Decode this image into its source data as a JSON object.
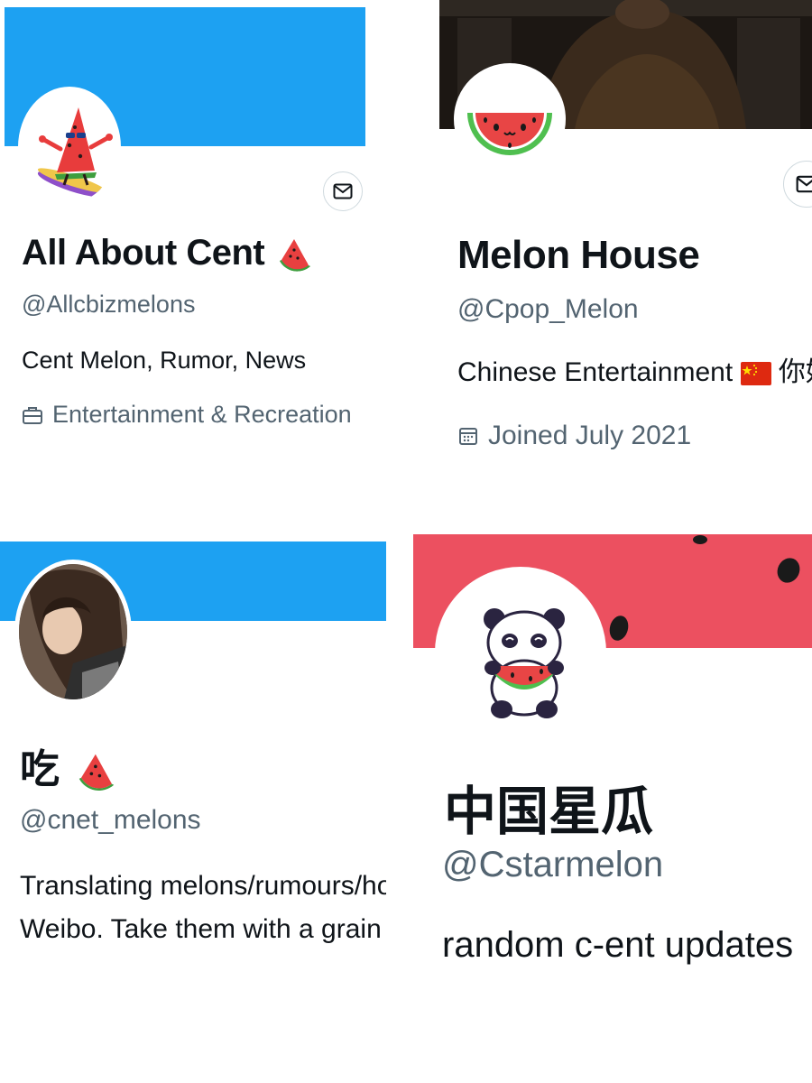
{
  "profiles": [
    {
      "banner_color": "#1da1f2",
      "display_name": "All About Cent",
      "name_emoji": "watermelon-icon",
      "handle": "@Allcbizmelons",
      "bio": "Cent Melon, Rumor, News",
      "meta_icon": "briefcase-icon",
      "meta_text": "Entertainment & Recreation",
      "has_message_button": true
    },
    {
      "banner_color": "#1c1713",
      "display_name": "Melon House",
      "handle": "@Cpop_Melon",
      "bio": "Chinese Entertainment",
      "bio_flag": "china-flag-icon",
      "bio_suffix": "你好",
      "meta_icon": "calendar-icon",
      "meta_text": "Joined July 2021",
      "has_message_button": true
    },
    {
      "banner_color": "#1da1f2",
      "display_name": "吃",
      "name_emoji": "watermelon-icon",
      "handle": "@cnet_melons",
      "bio_line1": "Translating melons/rumours/ho",
      "bio_line2": "Weibo. Take them with a grain o"
    },
    {
      "banner_color": "#ec5060",
      "display_name": "中国星瓜",
      "handle": "@Cstarmelon",
      "bio": "random c-ent updates"
    }
  ],
  "colors": {
    "text_primary": "#0f1419",
    "text_secondary": "#536471",
    "twitter_blue": "#1da1f2",
    "melon_red": "#ec5060"
  }
}
